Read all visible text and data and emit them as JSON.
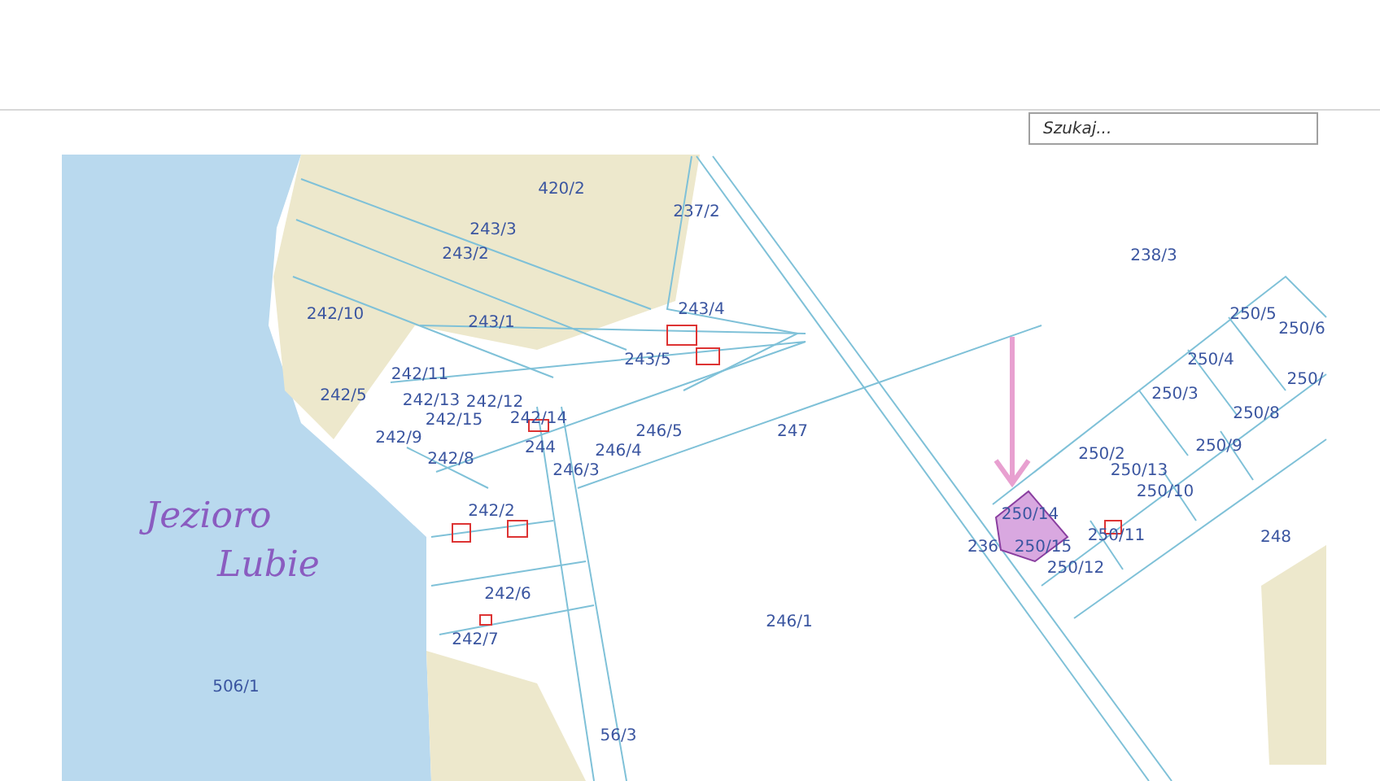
{
  "search": {
    "placeholder": "Szukaj..."
  },
  "map": {
    "handwriting": [
      "Jezioro",
      "Lubie"
    ],
    "parcels": [
      {
        "label": "420/2"
      },
      {
        "label": "237/2"
      },
      {
        "label": "243/3"
      },
      {
        "label": "243/2"
      },
      {
        "label": "242/10"
      },
      {
        "label": "243/1"
      },
      {
        "label": "243/4"
      },
      {
        "label": "243/5"
      },
      {
        "label": "242/11"
      },
      {
        "label": "242/5"
      },
      {
        "label": "242/13"
      },
      {
        "label": "242/12"
      },
      {
        "label": "242/15"
      },
      {
        "label": "242/14"
      },
      {
        "label": "242/9"
      },
      {
        "label": "242/8"
      },
      {
        "label": "244"
      },
      {
        "label": "246/5"
      },
      {
        "label": "246/4"
      },
      {
        "label": "246/3"
      },
      {
        "label": "247"
      },
      {
        "label": "242/2"
      },
      {
        "label": "242/6"
      },
      {
        "label": "242/7"
      },
      {
        "label": "56/3"
      },
      {
        "label": "246/1"
      },
      {
        "label": "506/1"
      },
      {
        "label": "238/3"
      },
      {
        "label": "250/5"
      },
      {
        "label": "250/6"
      },
      {
        "label": "250/4"
      },
      {
        "label": "250/3"
      },
      {
        "label": "250/"
      },
      {
        "label": "250/8"
      },
      {
        "label": "250/2"
      },
      {
        "label": "250/9"
      },
      {
        "label": "250/13"
      },
      {
        "label": "250/10"
      },
      {
        "label": "250/14"
      },
      {
        "label": "236"
      },
      {
        "label": "250/15"
      },
      {
        "label": "250/11"
      },
      {
        "label": "250/12"
      },
      {
        "label": "248"
      }
    ]
  }
}
